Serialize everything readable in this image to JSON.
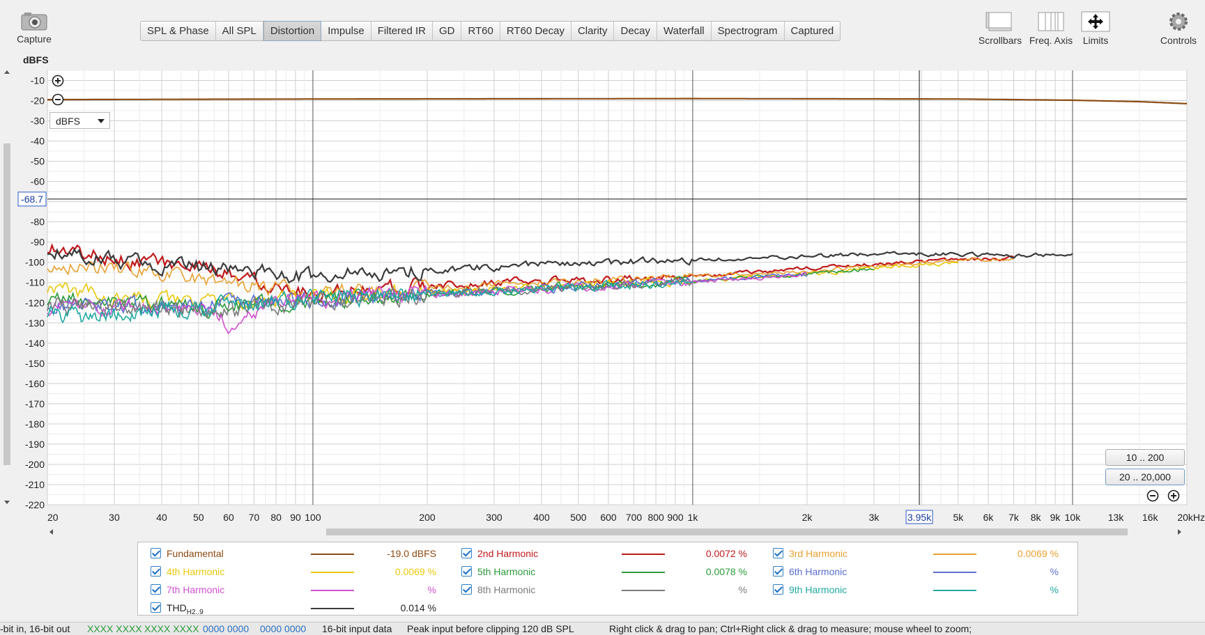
{
  "toolbar": {
    "capture_label": "Capture",
    "tabs": [
      "SPL & Phase",
      "All SPL",
      "Distortion",
      "Impulse",
      "Filtered IR",
      "GD",
      "RT60",
      "RT60 Decay",
      "Clarity",
      "Decay",
      "Waterfall",
      "Spectrogram",
      "Captured"
    ],
    "active_tab": "Distortion",
    "scrollbars_label": "Scrollbars",
    "freq_axis_label": "Freq. Axis",
    "limits_label": "Limits",
    "controls_label": "Controls"
  },
  "plot": {
    "y_unit_label": "dBFS",
    "unit_select_value": "dBFS",
    "y_ticks": [
      -10,
      -20,
      -30,
      -40,
      -50,
      -60,
      -70,
      -80,
      -90,
      -100,
      -110,
      -120,
      -130,
      -140,
      -150,
      -160,
      -170,
      -180,
      -190,
      -200,
      -210,
      -220
    ],
    "y_range": [
      -5,
      -220
    ],
    "x_range": [
      20,
      20000
    ],
    "x_scale": "log",
    "x_ticks": [
      {
        "v": 20,
        "label": "20"
      },
      {
        "v": 30,
        "label": "30"
      },
      {
        "v": 40,
        "label": "40"
      },
      {
        "v": 50,
        "label": "50"
      },
      {
        "v": 60,
        "label": "60"
      },
      {
        "v": 70,
        "label": "70"
      },
      {
        "v": 80,
        "label": "80"
      },
      {
        "v": 90,
        "label": "90"
      },
      {
        "v": 100,
        "label": "100"
      },
      {
        "v": 200,
        "label": "200"
      },
      {
        "v": 300,
        "label": "300"
      },
      {
        "v": 400,
        "label": "400"
      },
      {
        "v": 500,
        "label": "500"
      },
      {
        "v": 600,
        "label": "600"
      },
      {
        "v": 700,
        "label": "700"
      },
      {
        "v": 800,
        "label": "800"
      },
      {
        "v": 900,
        "label": "900"
      },
      {
        "v": 1000,
        "label": "1k"
      },
      {
        "v": 2000,
        "label": "2k"
      },
      {
        "v": 3000,
        "label": "3k"
      },
      {
        "v": 5000,
        "label": "5k"
      },
      {
        "v": 6000,
        "label": "6k"
      },
      {
        "v": 7000,
        "label": "7k"
      },
      {
        "v": 8000,
        "label": "8k"
      },
      {
        "v": 9000,
        "label": "9k"
      },
      {
        "v": 10000,
        "label": "10k"
      },
      {
        "v": 13000,
        "label": "13k"
      },
      {
        "v": 16000,
        "label": "16k"
      },
      {
        "v": 20000,
        "label": "20kHz"
      }
    ],
    "cursor": {
      "x": 3950,
      "x_label": "3.95k",
      "y": -68.7,
      "y_label": "-68.7"
    },
    "zoom_buttons": [
      "10 .. 200",
      "20 .. 20,000"
    ]
  },
  "chart_data": {
    "type": "line",
    "title": "",
    "xlabel": "",
    "ylabel": "dBFS",
    "x_scale": "log",
    "xlim": [
      20,
      20000
    ],
    "ylim": [
      -220,
      -5
    ],
    "series": [
      {
        "name": "Fundamental",
        "color": "#8b4a12",
        "points": [
          [
            20,
            -19.5
          ],
          [
            100,
            -19.2
          ],
          [
            1000,
            -19.0
          ],
          [
            5000,
            -19.2
          ],
          [
            10000,
            -19.8
          ],
          [
            15000,
            -20.5
          ],
          [
            20000,
            -21.5
          ]
        ]
      },
      {
        "name": "2nd Harmonic",
        "color": "#c0191c",
        "points": [
          [
            20,
            -92
          ],
          [
            25,
            -96
          ],
          [
            30,
            -98
          ],
          [
            40,
            -100
          ],
          [
            50,
            -104
          ],
          [
            60,
            -106
          ],
          [
            80,
            -110
          ],
          [
            100,
            -115
          ],
          [
            150,
            -112
          ],
          [
            200,
            -112
          ],
          [
            300,
            -110
          ],
          [
            500,
            -109
          ],
          [
            1000,
            -107
          ],
          [
            2000,
            -103
          ],
          [
            3000,
            -101
          ],
          [
            5000,
            -99
          ],
          [
            7000,
            -98
          ]
        ]
      },
      {
        "name": "3rd Harmonic",
        "color": "#e8a030",
        "points": [
          [
            20,
            -100
          ],
          [
            30,
            -103
          ],
          [
            40,
            -106
          ],
          [
            60,
            -110
          ],
          [
            80,
            -113
          ],
          [
            100,
            -115
          ],
          [
            200,
            -113
          ],
          [
            300,
            -111
          ],
          [
            500,
            -110
          ],
          [
            1000,
            -107
          ],
          [
            2000,
            -104
          ],
          [
            3000,
            -102
          ],
          [
            5000,
            -99
          ],
          [
            7000,
            -98
          ]
        ]
      },
      {
        "name": "4th Harmonic",
        "color": "#e8c80a",
        "points": [
          [
            20,
            -112
          ],
          [
            30,
            -118
          ],
          [
            50,
            -120
          ],
          [
            80,
            -118
          ],
          [
            100,
            -117
          ],
          [
            200,
            -115
          ],
          [
            400,
            -112
          ],
          [
            1000,
            -109
          ],
          [
            2000,
            -106
          ],
          [
            3000,
            -103
          ],
          [
            5000,
            -100
          ]
        ]
      },
      {
        "name": "5th Harmonic",
        "color": "#2a9a3a",
        "points": [
          [
            20,
            -118
          ],
          [
            30,
            -120
          ],
          [
            50,
            -122
          ],
          [
            80,
            -120
          ],
          [
            100,
            -118
          ],
          [
            200,
            -116
          ],
          [
            400,
            -113
          ],
          [
            1000,
            -109
          ],
          [
            2000,
            -106
          ],
          [
            3000,
            -103
          ]
        ]
      },
      {
        "name": "6th Harmonic",
        "color": "#5a6ed0",
        "points": [
          [
            20,
            -120
          ],
          [
            30,
            -122
          ],
          [
            50,
            -121
          ],
          [
            80,
            -119
          ],
          [
            100,
            -118
          ],
          [
            200,
            -116
          ],
          [
            400,
            -113
          ],
          [
            1000,
            -109
          ],
          [
            2000,
            -106
          ]
        ]
      },
      {
        "name": "7th Harmonic",
        "color": "#d050d0",
        "points": [
          [
            20,
            -122
          ],
          [
            30,
            -123
          ],
          [
            50,
            -122
          ],
          [
            60,
            -130
          ],
          [
            80,
            -120
          ],
          [
            100,
            -118
          ],
          [
            200,
            -116
          ],
          [
            400,
            -113
          ],
          [
            1000,
            -110
          ],
          [
            2000,
            -106
          ]
        ]
      },
      {
        "name": "8th Harmonic",
        "color": "#7a7a7a",
        "points": [
          [
            20,
            -121
          ],
          [
            30,
            -123
          ],
          [
            50,
            -124
          ],
          [
            80,
            -122
          ],
          [
            100,
            -119
          ],
          [
            200,
            -116
          ],
          [
            400,
            -113
          ],
          [
            1000,
            -110
          ]
        ]
      },
      {
        "name": "9th Harmonic",
        "color": "#20a8a0",
        "points": [
          [
            20,
            -124
          ],
          [
            25,
            -128
          ],
          [
            30,
            -125
          ],
          [
            50,
            -122
          ],
          [
            80,
            -120
          ],
          [
            100,
            -118
          ],
          [
            200,
            -116
          ],
          [
            400,
            -113
          ],
          [
            1000,
            -110
          ]
        ]
      },
      {
        "name": "THD",
        "color": "#3a3a3a",
        "points": [
          [
            20,
            -93
          ],
          [
            30,
            -99
          ],
          [
            40,
            -101
          ],
          [
            60,
            -104
          ],
          [
            80,
            -106
          ],
          [
            100,
            -107
          ],
          [
            150,
            -105
          ],
          [
            200,
            -104
          ],
          [
            400,
            -101
          ],
          [
            1000,
            -99
          ],
          [
            2000,
            -97
          ],
          [
            3000,
            -96
          ],
          [
            5000,
            -96
          ],
          [
            7000,
            -97
          ],
          [
            10000,
            -96
          ]
        ]
      }
    ]
  },
  "legend": [
    {
      "name": "Fundamental",
      "value": "-19.0 dBFS",
      "color": "#8b4a12"
    },
    {
      "name": "2nd Harmonic",
      "value": "0.0072 %",
      "color": "#c0191c"
    },
    {
      "name": "3rd Harmonic",
      "value": "0.0069 %",
      "color": "#e8a030"
    },
    {
      "name": "4th Harmonic",
      "value": "0.0069 %",
      "color": "#e8c80a"
    },
    {
      "name": "5th Harmonic",
      "value": "0.0078 %",
      "color": "#2a9a3a"
    },
    {
      "name": "6th Harmonic",
      "value": "%",
      "color": "#5a6ed0"
    },
    {
      "name": "7th Harmonic",
      "value": "%",
      "color": "#d050d0"
    },
    {
      "name": "8th Harmonic",
      "value": "%",
      "color": "#7a7a7a"
    },
    {
      "name": "9th Harmonic",
      "value": "%",
      "color": "#20a8a0"
    }
  ],
  "thd_legend": {
    "name": "THD",
    "subscript": "H2..9",
    "value": "0.014 %",
    "color": "#3a3a3a"
  },
  "status": {
    "bits": "-bit in, 16-bit out",
    "meter1": "XXXX XXXX",
    "meter2": "XXXX XXXX",
    "meter3": "0000 0000",
    "meter4": "0000 0000",
    "input_data": "16-bit input data",
    "peak": "Peak input before clipping 120 dB SPL",
    "hint": "Right click & drag to pan; Ctrl+Right click & drag to measure; mouse wheel to zoom;"
  }
}
